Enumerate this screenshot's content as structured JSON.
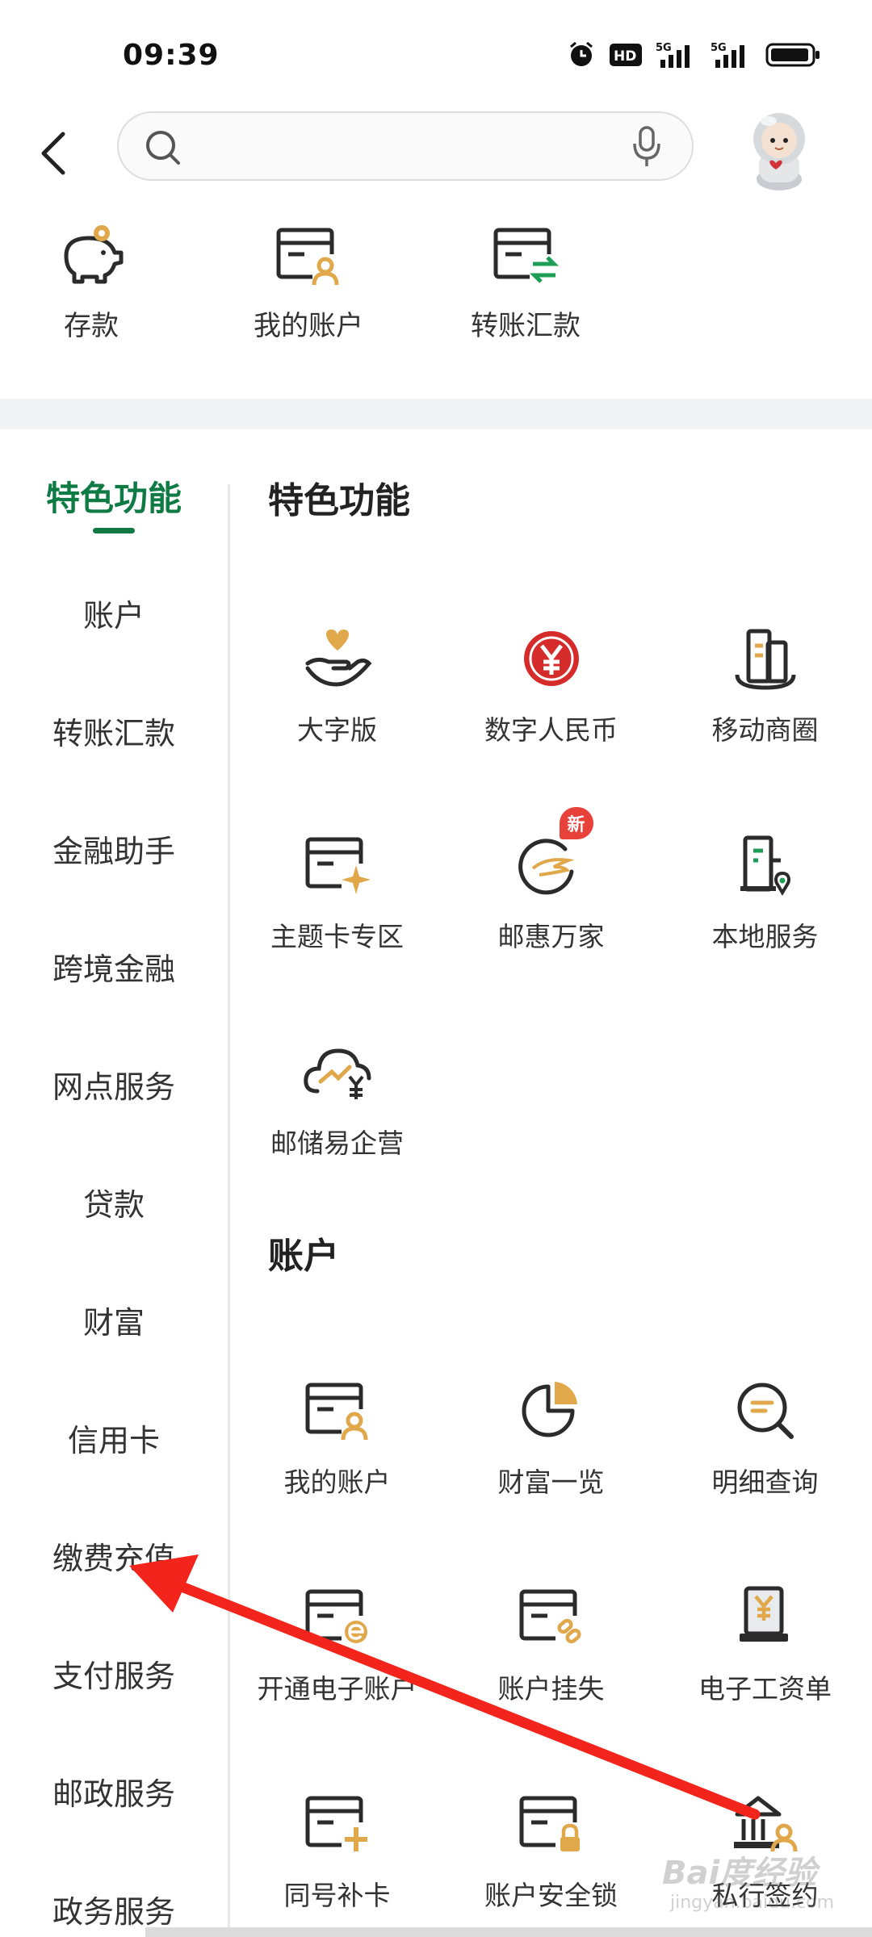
{
  "status": {
    "time": "09:39",
    "hd_label": "HD",
    "net1": "5G",
    "net2": "5G"
  },
  "search": {
    "placeholder": ""
  },
  "quick_actions": [
    {
      "label": "存款",
      "icon": "piggy-bank-icon"
    },
    {
      "label": "我的账户",
      "icon": "account-card-icon"
    },
    {
      "label": "转账汇款",
      "icon": "transfer-icon"
    }
  ],
  "sidebar": {
    "items": [
      {
        "label": "特色功能",
        "active": true
      },
      {
        "label": "账户"
      },
      {
        "label": "转账汇款"
      },
      {
        "label": "金融助手"
      },
      {
        "label": "跨境金融"
      },
      {
        "label": "网点服务"
      },
      {
        "label": "贷款"
      },
      {
        "label": "财富"
      },
      {
        "label": "信用卡"
      },
      {
        "label": "缴费充值"
      },
      {
        "label": "支付服务"
      },
      {
        "label": "邮政服务"
      },
      {
        "label": "政务服务"
      }
    ]
  },
  "sections": [
    {
      "title": "特色功能",
      "items": [
        {
          "label": "大字版",
          "icon": "heart-hand-icon"
        },
        {
          "label": "数字人民币",
          "icon": "digital-rmb-icon"
        },
        {
          "label": "移动商圈",
          "icon": "mobile-mall-icon"
        },
        {
          "label": "主题卡专区",
          "icon": "theme-card-icon"
        },
        {
          "label": "邮惠万家",
          "icon": "youhui-icon",
          "badge": "新"
        },
        {
          "label": "本地服务",
          "icon": "local-service-icon"
        },
        {
          "label": "邮储易企营",
          "icon": "cloud-chart-icon"
        }
      ]
    },
    {
      "title": "账户",
      "items": [
        {
          "label": "我的账户",
          "icon": "account-card-icon"
        },
        {
          "label": "财富一览",
          "icon": "pie-chart-icon"
        },
        {
          "label": "明细查询",
          "icon": "detail-search-icon"
        },
        {
          "label": "开通电子账户",
          "icon": "e-account-icon"
        },
        {
          "label": "账户挂失",
          "icon": "account-loss-icon"
        },
        {
          "label": "电子工资单",
          "icon": "payslip-icon"
        },
        {
          "label": "同号补卡",
          "icon": "card-replace-icon"
        },
        {
          "label": "账户安全锁",
          "icon": "account-lock-icon"
        },
        {
          "label": "私行签约",
          "icon": "private-bank-icon"
        }
      ]
    }
  ],
  "watermark": {
    "text": "Bai度经验",
    "sub": "jingyan.baidu.com"
  },
  "colors": {
    "accent_green": "#0f7a43",
    "icon_dark": "#2b2b2b",
    "icon_gold": "#e0a84a",
    "badge_red": "#e8413a",
    "arrow_red": "#f2241b"
  }
}
